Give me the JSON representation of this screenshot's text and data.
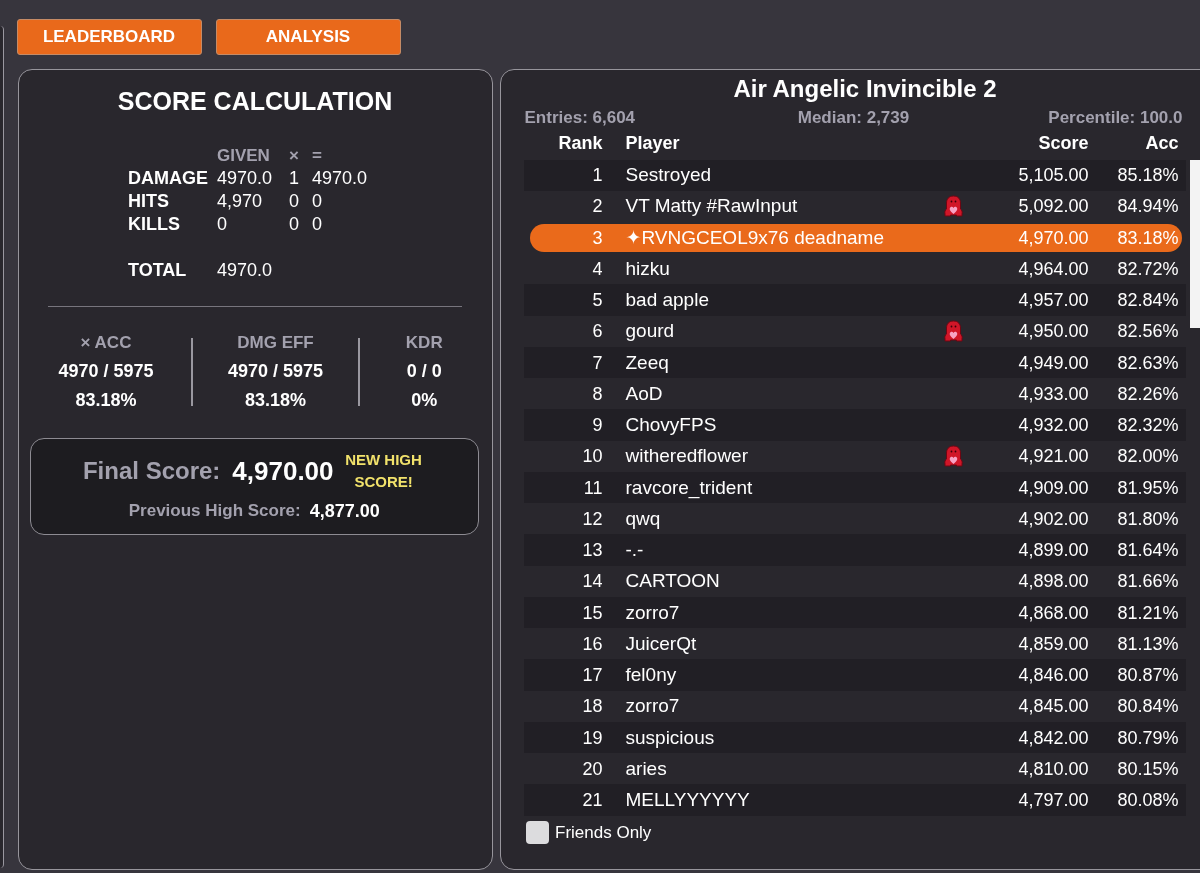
{
  "buttons": [
    "LEADERBOARD",
    "ANALYSIS"
  ],
  "score_calculation": {
    "title": "SCORE CALCULATION",
    "columns": [
      "GIVEN",
      "×",
      "="
    ],
    "rows": [
      {
        "label": "DAMAGE",
        "given": "4970.0",
        "multiplier": "1",
        "result": "4970.0"
      },
      {
        "label": "HITS",
        "given": "4,970",
        "multiplier": "0",
        "result": "0"
      },
      {
        "label": "KILLS",
        "given": "0",
        "multiplier": "0",
        "result": "0"
      }
    ],
    "total": {
      "label": "TOTAL",
      "value": "4970.0"
    }
  },
  "stats": [
    {
      "label": "× ACC",
      "ratio": "4970 / 5975",
      "percent": "83.18%"
    },
    {
      "label": "DMG EFF",
      "ratio": "4970 / 5975",
      "percent": "83.18%"
    },
    {
      "label": "KDR",
      "ratio": "0 / 0",
      "percent": "0%"
    }
  ],
  "final_score": {
    "label": "Final Score:",
    "value": "4,970.00",
    "note": "NEW HIGH SCORE!",
    "previous_label": "Previous High Score:",
    "previous_value": "4,877.00"
  },
  "leaderboard": {
    "title": "Air Angelic Invincible 2",
    "entries": "Entries: 6,604",
    "median": "Median: 2,739",
    "percentile": "Percentile: 100.0",
    "columns": [
      "Rank",
      "Player",
      "Score",
      "Acc"
    ],
    "rows": [
      {
        "rank": "1",
        "player": "Sestroyed",
        "friend": false,
        "score": "5,105.00",
        "acc": "85.18%",
        "selected": false
      },
      {
        "rank": "2",
        "player": "VT Matty #RawInput",
        "friend": true,
        "score": "5,092.00",
        "acc": "84.94%",
        "selected": false
      },
      {
        "rank": "3",
        "player": "✦RVNGCEOL9x76 deadname",
        "friend": false,
        "score": "4,970.00",
        "acc": "83.18%",
        "selected": true
      },
      {
        "rank": "4",
        "player": "hizku",
        "friend": false,
        "score": "4,964.00",
        "acc": "82.72%",
        "selected": false
      },
      {
        "rank": "5",
        "player": "bad apple",
        "friend": false,
        "score": "4,957.00",
        "acc": "82.84%",
        "selected": false
      },
      {
        "rank": "6",
        "player": "gourd",
        "friend": true,
        "score": "4,950.00",
        "acc": "82.56%",
        "selected": false
      },
      {
        "rank": "7",
        "player": "Zeeq",
        "friend": false,
        "score": "4,949.00",
        "acc": "82.63%",
        "selected": false
      },
      {
        "rank": "8",
        "player": "AoD",
        "friend": false,
        "score": "4,933.00",
        "acc": "82.26%",
        "selected": false
      },
      {
        "rank": "9",
        "player": "ChovyFPS",
        "friend": false,
        "score": "4,932.00",
        "acc": "82.32%",
        "selected": false
      },
      {
        "rank": "10",
        "player": "witheredflower",
        "friend": true,
        "score": "4,921.00",
        "acc": "82.00%",
        "selected": false
      },
      {
        "rank": "11",
        "player": "ravcore_trident",
        "friend": false,
        "score": "4,909.00",
        "acc": "81.95%",
        "selected": false
      },
      {
        "rank": "12",
        "player": "qwq",
        "friend": false,
        "score": "4,902.00",
        "acc": "81.80%",
        "selected": false
      },
      {
        "rank": "13",
        "player": "-.-",
        "friend": false,
        "score": "4,899.00",
        "acc": "81.64%",
        "selected": false
      },
      {
        "rank": "14",
        "player": "CARTOON",
        "friend": false,
        "score": "4,898.00",
        "acc": "81.66%",
        "selected": false
      },
      {
        "rank": "15",
        "player": "zorro7",
        "friend": false,
        "score": "4,868.00",
        "acc": "81.21%",
        "selected": false
      },
      {
        "rank": "16",
        "player": "JuicerQt",
        "friend": false,
        "score": "4,859.00",
        "acc": "81.13%",
        "selected": false
      },
      {
        "rank": "17",
        "player": "fel0ny",
        "friend": false,
        "score": "4,846.00",
        "acc": "80.87%",
        "selected": false
      },
      {
        "rank": "18",
        "player": "zorro7",
        "friend": false,
        "score": "4,845.00",
        "acc": "80.84%",
        "selected": false
      },
      {
        "rank": "19",
        "player": "suspicious",
        "friend": false,
        "score": "4,842.00",
        "acc": "80.79%",
        "selected": false
      },
      {
        "rank": "20",
        "player": "aries",
        "friend": false,
        "score": "4,810.00",
        "acc": "80.15%",
        "selected": false
      },
      {
        "rank": "21",
        "player": "MELLYYYYYY",
        "friend": false,
        "score": "4,797.00",
        "acc": "80.08%",
        "selected": false
      }
    ],
    "friends_only": {
      "label": "Friends Only",
      "checked": false
    }
  }
}
